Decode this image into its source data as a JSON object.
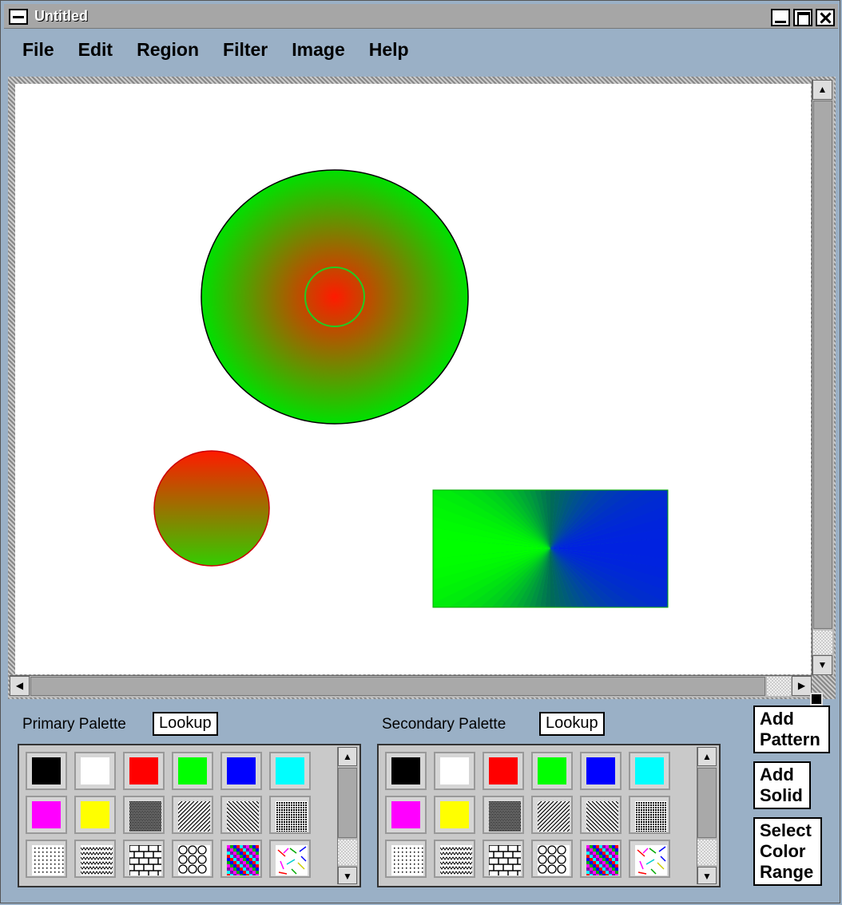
{
  "window": {
    "title": "Untitled"
  },
  "menu": [
    {
      "label": "File"
    },
    {
      "label": "Edit"
    },
    {
      "label": "Region"
    },
    {
      "label": "Filter"
    },
    {
      "label": "Image"
    },
    {
      "label": "Help"
    }
  ],
  "canvas": {
    "shapes": [
      {
        "kind": "radial-circle",
        "inner": "#ff1a00",
        "outer": "#00e000",
        "outline": "#000000"
      },
      {
        "kind": "vertical-circle",
        "top": "#ff1a00",
        "bottom": "#33cc00",
        "outline": "#cc0000"
      },
      {
        "kind": "angular-rect",
        "left": "#00ff00",
        "right": "#0022e0",
        "outline": "#00aa00"
      }
    ]
  },
  "primary": {
    "label": "Primary Palette",
    "lookup": "Lookup"
  },
  "secondary": {
    "label": "Secondary Palette",
    "lookup": "Lookup"
  },
  "swatches": [
    "#000000",
    "#ffffff",
    "#ff0000",
    "#00ff00",
    "#0000ff",
    "#00ffff",
    "#ff00ff",
    "#ffff00",
    "pattern-dots-dense",
    "pattern-diag-right",
    "pattern-diag-left",
    "pattern-grid",
    "pattern-dots-sparse",
    "pattern-zigzag",
    "pattern-brick",
    "pattern-circles",
    "pattern-color-tiles",
    "pattern-confetti"
  ],
  "buttons": {
    "add_pattern": "Add Pattern",
    "add_solid": "Add Solid",
    "select_color_range": "Select Color Range"
  }
}
